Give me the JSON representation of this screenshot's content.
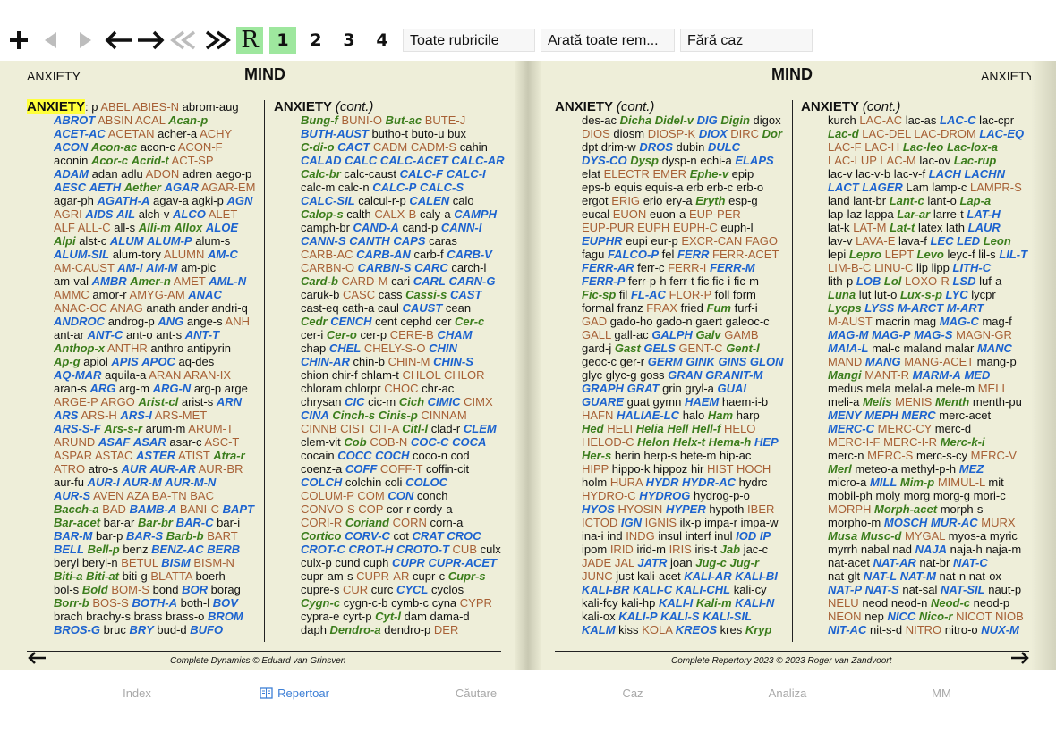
{
  "toolbar": {
    "icons": [
      "plus-icon",
      "back-icon",
      "forward-icon",
      "arrow-left-icon",
      "arrow-right-icon",
      "double-left-icon",
      "double-right-icon"
    ],
    "r_label": "R",
    "levels": [
      "1",
      "2",
      "3",
      "4"
    ],
    "selected_level": "1",
    "filter_rubrics": "Toate rubricile",
    "filter_remedies": "Arată toate rem...",
    "case": "Fără caz"
  },
  "left_page": {
    "corner_label": "ANXIETY",
    "chapter": "MIND",
    "footer": "Complete Dynamics © Eduard van Grinsven",
    "columns": [
      [
        "ANXIETY: p ABEL|o ABIES-N|o abrom-aug|p",
        "ABROT|b ABSIN|o ACAL|o Acan-p|g",
        "ACET-AC|b ACETAN|o acher-a|p ACHY|o",
        "ACON|b Acon-ac|g acon-c|p ACON-F|o",
        "aconin|p Acor-c|g Acrid-t|g ACT-SP|o",
        "ADAM|b adan|p adlu|p ADON|o adren|p aego-p|p",
        "AESC|b AETH|b Aether|g AGAR|b AGAR-EM|o",
        "agar-ph|p AGATH-A|b agav-a|p agki-p|p AGN|b",
        "AGRI|o AIDS|b AIL|b alch-v|p ALCO|b ALET|o",
        "ALF|o ALL-C|o all-s|p Alli-m|g Allox|g ALOE|b",
        "Alpi|g alst-c|p ALUM|b ALUM-P|b alum-s|p",
        "ALUM-SIL|b alum-tory|p ALUMN|o AM-C|b",
        "AM-CAUST|o AM-I|b AM-M|b am-pic|p",
        "am-val|p AMBR|b Amer-n|g AMET|o AML-N|b",
        "AMMC|o amor-r|p AMYG-AM|o ANAC|b",
        "ANAC-OC|o ANAG|o anath|p ander|p andri-q|p",
        "ANDROC|b androg-p|p ANG|b ange-s|p ANH|o",
        "ant-ar|p ANT-C|b ant-o|p ant-s|p ANT-T|b",
        "Anthop-x|g ANTHR|o anthro|p antipyrin|p",
        "Ap-g|g apiol|p APIS|b APOC|b aq-des|p",
        "AQ-MAR|b aquila-a|p ARAN|o ARAN-IX|o",
        "aran-s|p ARG|b arg-m|p ARG-N|b arg-p|p arge|p",
        "ARGE-P|o ARGO|o Arist-cl|g arist-s|p ARN|b",
        "ARS|b ARS-H|o ARS-I|b ARS-MET|o",
        "ARS-S-F|b Ars-s-r|g arum-m|p ARUM-T|o",
        "ARUND|o ASAF|b ASAR|b asar-c|p ASC-T|o",
        "ASPAR|o ASTAC|o ASTER|b ATIST|o Atra-r|g",
        "ATRO|o atro-s|p AUR|b AUR-AR|b AUR-BR|o",
        "aur-fu|p AUR-I|b AUR-M|b AUR-M-N|b",
        "AUR-S|b AVEN|o AZA|o BA-TN|o BAC|o",
        "Bacch-a|g BAD|o BAMB-A|b BANI-C|o BAPT|b",
        "Bar-acet|g bar-ar|p Bar-br|g BAR-C|b bar-i|p",
        "BAR-M|b bar-p|p BAR-S|b Barb-b|g BART|o",
        "BELL|b Bell-p|g benz|p BENZ-AC|b BERB|b",
        "beryl|p beryl-n|p BETUL|o BISM|b BISM-N|o",
        "Biti-a|g Biti-at|g biti-g|p BLATTA|o boerh|p",
        "bol-s|p Bold|g BOM-S|o bond|p BOR|b borag|p",
        "Borr-b|g BOS-S|o BOTH-A|b both-l|p BOV|b",
        "brach|p brachy-s|p brass|p brass-o|p BROM|b",
        "BROS-G|b bruc|p BRY|b bud-d|p BUFO|b"
      ],
      [
        "ANXIETY (cont.)",
        "Bung-f|g BUNI-O|o But-ac|g BUTE-J|o",
        "BUTH-AUST|b butho-t|p buto-u|p bux|p",
        "C-di-o|g CACT|b CADM|o CADM-S|o cahin|p",
        "CALAD|b CALC|b CALC-ACET|b CALC-AR|b",
        "Calc-br|g calc-caust|p CALC-F|b CALC-I|b",
        "calc-m|p calc-n|p CALC-P|b CALC-S|b",
        "CALC-SIL|b calcul-r-p|p CALEN|b calo|p",
        "Calop-s|g calth|p CALX-B|o caly-a|p CAMPH|b",
        "camph-br|p CAND-A|b cand-p|p CANN-I|b",
        "CANN-S|b CANTH|b CAPS|b caras|p",
        "CARB-AC|o CARB-AN|b carb-f|p CARB-V|b",
        "CARBN-O|o CARBN-S|b CARC|b carch-l|p",
        "Card-b|g CARD-M|o cari|p CARL|b CARN-G|b",
        "caruk-b|p CASC|o cass|p Cassi-s|g CAST|b",
        "cast-eq|p cath-a|p caul|p CAUST|b cean|p",
        "Cedr|g CENCH|b cent|p cephd|p cer|p Cer-c|g",
        "cer-i|p Cer-o|g cer-p|p CERE-B|o CHAM|b",
        "chap|p CHEL|b CHELY-S-O|o CHIN|b",
        "CHIN-AR|b chin-b|p CHIN-M|o CHIN-S|b",
        "chion|p chir-f|p chlam-t|p CHLOL|o CHLOR|o",
        "chloram|p chlorpr|p CHOC|o chr-ac|p",
        "chrysan|p CIC|b cic-m|p Cich|g CIMIC|b CIMX|o",
        "CINA|b Cinch-s|g Cinis-p|g CINNAM|o",
        "CINNB|o CIST|o CIT-A|o Citl-l|g clad-r|p CLEM|b",
        "clem-vit|p Cob|g COB-N|o COC-C|b COCA|b",
        "cocain|p COCC|b COCH|b coco-n|p cod|p",
        "coenz-a|p COFF|b COFF-T|o coffin-cit|p",
        "COLCH|b colchin|p coli|p COLOC|b",
        "COLUM-P|o COM|o CON|b conch|p",
        "CONVO-S|o COP|o cor-r|p cordy-a|p",
        "CORI-R|o Coriand|g CORN|o corn-a|p",
        "Cortico|g CORV-C|b cot|p CRAT|b CROC|b",
        "CROT-C|b CROT-H|b CROTO-T|b CUB|o culx|p",
        "culx-p|p cund|p cuph|p CUPR|b CUPR-ACET|b",
        "cupr-am-s|p CUPR-AR|o cupr-c|p Cupr-s|g",
        "cupre-s|p CUR|o curc|p CYCL|b cyclos|p",
        "Cygn-c|g cygn-c-b|p cymb-c|p cyna|p CYPR|o",
        "cypra-e|p cyrt-p|p Cyt-l|g dam|p dama-d|p",
        "daph|p Dendro-a|g dendro-p|p DER|o"
      ]
    ]
  },
  "right_page": {
    "corner_label": "ANXIETY",
    "chapter": "MIND",
    "footer": "Complete Repertory 2023 © 2023 Roger van Zandvoort",
    "columns": [
      [
        "ANXIETY (cont.)",
        "des-ac|p Dicha|g Didel-v|g DIG|b Digin|g digox|p",
        "DIOS|o diosm|p DIOSP-K|o DIOX|b DIRC|o Dor|g",
        "dpt|p drim-w|p DROS|b dubin|p DULC|b",
        "DYS-CO|b Dysp|g dysp-n|p echi-a|p ELAPS|b",
        "elat|p ELECTR|o EMER|o Ephe-v|g epip|p",
        "eps-b|p equis|p equis-a|p erb|p erb-c|p erb-o|p",
        "ergot|p ERIG|o erio|p ery-a|p Eryth|g esp-g|p",
        "eucal|p EUON|o euon-a|p EUP-PER|o",
        "EUP-PUR|o EUPH|o EUPH-C|o euph-l|p",
        "EUPHR|b eupi|p eur-p|p EXCR-CAN|o FAGO|o",
        "fagu|p FALCO-P|b fel|p FERR|b FERR-ACET|o",
        "FERR-AR|b ferr-c|p FERR-I|o FERR-M|b",
        "FERR-P|b ferr-p-h|p ferr-t|p fic|p fic-i|p fic-m|p",
        "Fic-sp|g fil|p FL-AC|b FLOR-P|o foll|p form|p",
        "formal|p franz|p FRAX|o fried|p Fum|g furf-i|p",
        "GAD|o gado-ho|p gado-n|p gaert|p galeoc-c|p",
        "GALL|o gall-ac|p GALPH|b Galv|g GAMB|o",
        "gard-j|p Gast|g GELS|b GENT-C|o Gent-l|g",
        "geoc-c|p ger-r|p GERM|b GINK|b GINS|b GLON|b",
        "glyc|p glyc-g|p goss|p GRAN|b GRANIT-M|b",
        "GRAPH|b GRAT|b grin|p gryl-a|p GUAI|b",
        "GUARE|b guat|p gymn|p HAEM|b haem-i-b|p",
        "HAFN|o HALIAE-LC|b halo|p Ham|g harp|p",
        "Hed|g HELI|o Helia|g Hell|g Hell-f|g HELO|o",
        "HELOD-C|o Helon|g Helx-t|g Hema-h|g HEP|b",
        "Her-s|g herin|p herp-s|p hete-m|p hip-ac|p",
        "HIPP|o hippo-k|p hippoz|p hir|p HIST|o HOCH|o",
        "holm|p HURA|o HYDR|b HYDR-AC|b hydrc|p",
        "HYDRO-C|o HYDROG|b hydrog-p-o|p",
        "HYOS|b HYOSIN|o HYPER|b hypoth|p IBER|o",
        "ICTOD|o IGN|b IGNIS|o ilx-p|p impa-r|p impa-w|p",
        "ina-i|p ind|p INDG|o insul|p interf|p inul|p IOD|b IP|b",
        "ipom|p IRID|o irid-m|p IRIS|o iris-t|p Jab|g jac-c|p",
        "JADE|o JAL|o JATR|b joan|p Jug-c|g Jug-r|g",
        "JUNC|o just|p kali-acet|p KALI-AR|b KALI-BI|b",
        "KALI-BR|b KALI-C|b KALI-CHL|b kali-cy|p",
        "kali-fcy|p kali-hp|p KALI-I|b Kali-m|g KALI-N|b",
        "kali-ox|p KALI-P|b KALI-S|b KALI-SIL|b",
        "KALM|b kiss|p KOLA|o KREOS|b kres|p Kryp|g"
      ],
      [
        "ANXIETY (cont.)",
        "kurch|p LAC-AC|o lac-as|p LAC-C|b lac-cpr|p",
        "Lac-d|g LAC-DEL|o LAC-DROM|o LAC-EQ|b",
        "LAC-F|o LAC-H|o Lac-leo|g Lac-lox-a|g",
        "LAC-LUP|o LAC-M|o lac-ov|p Lac-rup|g",
        "lac-v|p lac-v-b|p lac-v-f|p LACH|b LACHN|b",
        "LACT|b LAGER|b Lam|p lamp-c|p LAMPR-S|o",
        "land|p lant-br|p Lant-c|g lant-o|p Lap-a|g",
        "lap-laz|p lappa|p Lar-ar|g larre-t|p LAT-H|b",
        "lat-k|p LAT-M|o Lat-t|g latex|p lath|p LAUR|b",
        "lav-v|p LAVA-E|o lava-f|p LEC|b LED|b Leon|g",
        "lepi|p Lepro|g LEPT|o Levo|g leyc-f|p lil-s|p LIL-T|b",
        "LIM-B-C|o LINU-C|o lip|p lipp|p LITH-C|b",
        "lith-p|p LOB|b Lol|g LOXO-R|o LSD|b luf-a|p",
        "Luna|g lut|p lut-o|p Lux-s-p|g LYC|b lycpr|p",
        "Lycps|g LYSS|b M-ARCT|b M-ART|b",
        "M-AUST|o macrin|p mag|p MAG-C|b mag-f|p",
        "MAG-M|b MAG-P|b MAG-S|b MAGN-GR|o",
        "MAIA-L|b mal-c|p maland|p malar|p MANC|b",
        "MAND|o MANG|b MANG-ACET|o mang-p|p",
        "Mangi|g MANT-R|o MARM-A|b MED|b",
        "medus|p mela|p melal-a|p mele-m|p MELI|o",
        "meli-a|p Melis|g MENIS|o Menth|g menth-pu|p",
        "MENY|b MEPH|b MERC|b merc-acet|p",
        "MERC-C|b MERC-CY|o merc-d|p",
        "MERC-I-F|o MERC-I-R|o Merc-k-i|g",
        "merc-n|p MERC-S|o merc-s-cy|p MERC-V|o",
        "Merl|g meteo-a|p methyl-p-h|p MEZ|b",
        "micro-a|p MILL|b Mim-p|g MIMUL-L|o mit|p",
        "mobil-ph|p moly|p morg|p morg-g|p mori-c|p",
        "MORPH|o Morph-acet|g morph-s|p",
        "morpho-m|p MOSCH|b MUR-AC|b MURX|o",
        "Musa|g Musc-d|g MYGAL|o myos-a|p myric|p",
        "myrrh|p nabal|p nad|p NAJA|b naja-h|p naja-m|p",
        "nat-acet|p NAT-AR|b nat-br|p NAT-C|b",
        "nat-glt|p NAT-L|b NAT-M|b nat-n|p nat-ox|p",
        "NAT-P|b NAT-S|b nat-sal|p NAT-SIL|b naut-p|p",
        "NELU|o neod|p neod-n|p Neod-c|g neod-p|p",
        "NEON|o nep|p NICC|b Nico-r|g NICOT|o NIOB|o",
        "NIT-AC|b nit-s-d|p NITRO|o nitro-o|p NUX-M|b"
      ]
    ]
  },
  "tabbar": {
    "tabs": [
      "Index",
      "Repertoar",
      "Căutare",
      "Caz",
      "Analiza",
      "MM"
    ],
    "active": "Repertoar"
  },
  "colors": {
    "page": "#eeeed9",
    "bold_remedy": "#1c63cf",
    "plain_caps": "#a76035",
    "italic_green": "#3b7d1c",
    "selected_level": "#9ee79e",
    "highlight": "#ffff3a"
  }
}
